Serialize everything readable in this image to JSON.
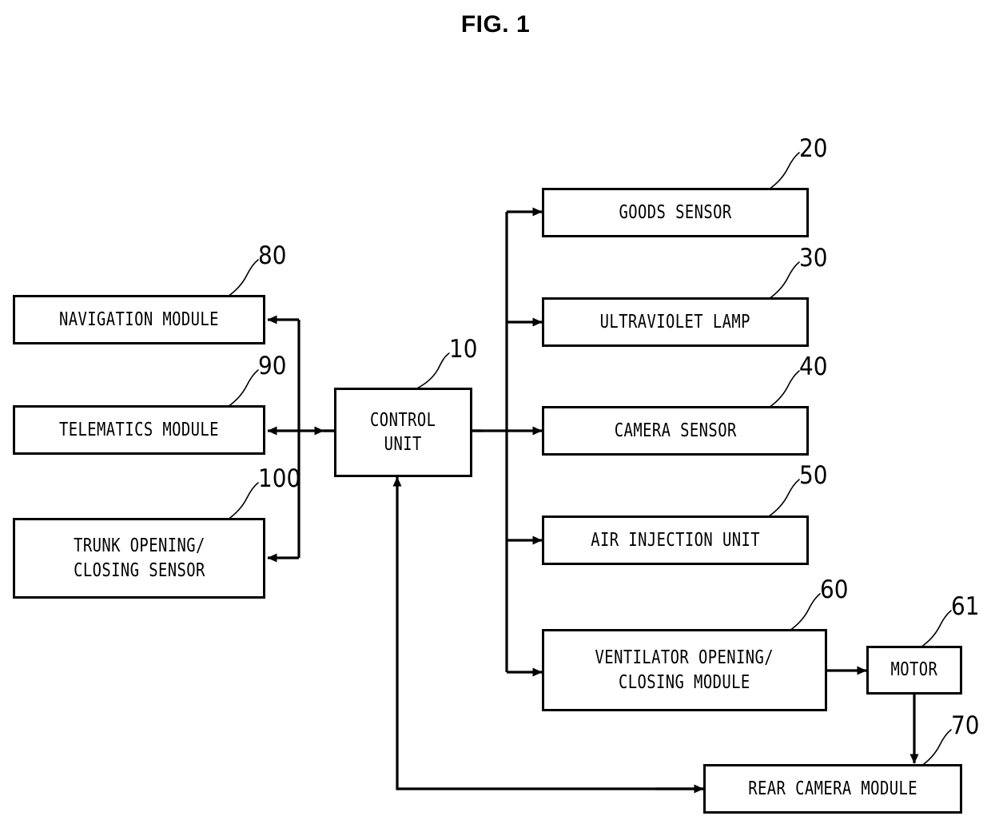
{
  "figure": {
    "title": "FIG. 1",
    "type": "patent-block-diagram",
    "ink_color": "#000000",
    "background_color": "#ffffff"
  },
  "nodes": {
    "control_unit": {
      "label": "CONTROL\nUNIT",
      "ref": "10"
    },
    "goods_sensor": {
      "label": "GOODS SENSOR",
      "ref": "20"
    },
    "uv_lamp": {
      "label": "ULTRAVIOLET LAMP",
      "ref": "30"
    },
    "camera_sensor": {
      "label": "CAMERA SENSOR",
      "ref": "40"
    },
    "air_injection": {
      "label": "AIR INJECTION UNIT",
      "ref": "50"
    },
    "ventilator": {
      "label": "VENTILATOR OPENING/\nCLOSING MODULE",
      "ref": "60"
    },
    "motor": {
      "label": "MOTOR",
      "ref": "61"
    },
    "rear_camera": {
      "label": "REAR CAMERA MODULE",
      "ref": "70"
    },
    "navigation": {
      "label": "NAVIGATION MODULE",
      "ref": "80"
    },
    "telematics": {
      "label": "TELEMATICS MODULE",
      "ref": "90"
    },
    "trunk_sensor": {
      "label": "TRUNK OPENING/\nCLOSING SENSOR",
      "ref": "100"
    }
  },
  "connections": [
    {
      "from": "control_unit",
      "to": "goods_sensor",
      "direction": "one-way"
    },
    {
      "from": "control_unit",
      "to": "uv_lamp",
      "direction": "one-way"
    },
    {
      "from": "control_unit",
      "to": "camera_sensor",
      "direction": "two-way"
    },
    {
      "from": "control_unit",
      "to": "air_injection",
      "direction": "one-way"
    },
    {
      "from": "control_unit",
      "to": "ventilator",
      "direction": "one-way"
    },
    {
      "from": "ventilator",
      "to": "motor",
      "direction": "one-way"
    },
    {
      "from": "motor",
      "to": "rear_camera",
      "direction": "one-way"
    },
    {
      "from": "rear_camera",
      "to": "control_unit",
      "direction": "one-way"
    },
    {
      "from": "control_unit",
      "to": "navigation",
      "direction": "one-way"
    },
    {
      "from": "control_unit",
      "to": "telematics",
      "direction": "two-way"
    },
    {
      "from": "control_unit",
      "to": "trunk_sensor",
      "direction": "one-way"
    }
  ]
}
